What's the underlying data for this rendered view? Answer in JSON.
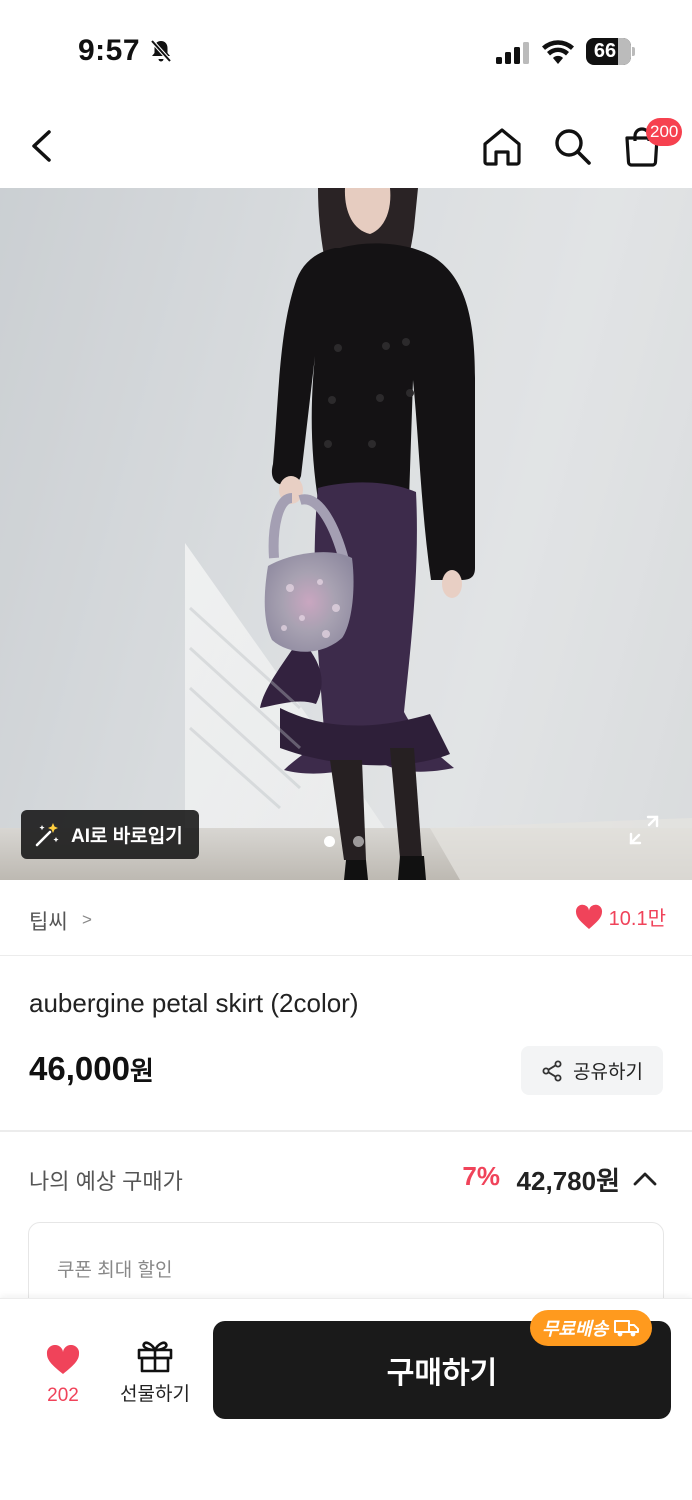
{
  "status_bar": {
    "time": "9:57",
    "battery": "66"
  },
  "nav": {
    "cart_badge": "200"
  },
  "hero": {
    "ai_button_label": "AI로 바로입기",
    "slide_dots": 2,
    "active_slide": 1
  },
  "product": {
    "brand": "팁씨",
    "brand_chevron": ">",
    "likes": "10.1만",
    "title": "aubergine petal skirt (2color)",
    "price": "46,000",
    "price_unit": "원",
    "share_label": "공유하기"
  },
  "estimate": {
    "label": "나의 예상 구매가",
    "discount_rate": "7%",
    "estimated_price": "42,780원"
  },
  "coupon": {
    "label": "쿠폰 최대 할인"
  },
  "bottom_bar": {
    "wish_count": "202",
    "gift_label": "선물하기",
    "buy_label": "구매하기",
    "free_shipping_label": "무료배송"
  },
  "colors": {
    "accent_red": "#f0435a",
    "badge_red": "#f6414f",
    "free_ship_orange": "#ff9a1e",
    "buy_button": "#1a1a1a"
  }
}
